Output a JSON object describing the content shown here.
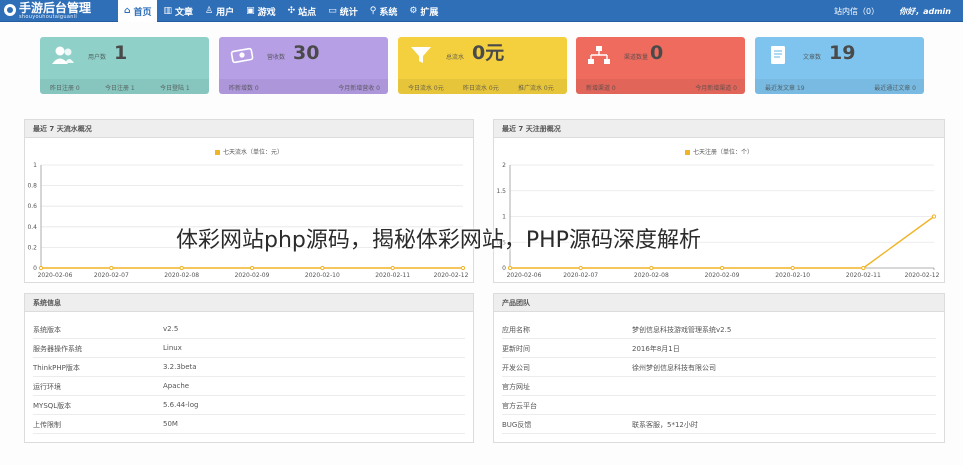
{
  "header": {
    "logo_title": "手游后台管理",
    "logo_sub": "shouyouhoutaiguanli",
    "nav": [
      {
        "label": "首页",
        "icon": "home-icon",
        "glyph": "⌂",
        "active": true
      },
      {
        "label": "文章",
        "icon": "bar-chart-icon",
        "glyph": "▥",
        "active": false
      },
      {
        "label": "用户",
        "icon": "user-icon",
        "glyph": "♙",
        "active": false
      },
      {
        "label": "游戏",
        "icon": "gamepad-icon",
        "glyph": "▣",
        "active": false
      },
      {
        "label": "站点",
        "icon": "sitemap-icon",
        "glyph": "✣",
        "active": false
      },
      {
        "label": "统计",
        "icon": "monitor-icon",
        "glyph": "▭",
        "active": false
      },
      {
        "label": "系统",
        "icon": "link-icon",
        "glyph": "⚲",
        "active": false
      },
      {
        "label": "扩展",
        "icon": "gear-icon",
        "glyph": "⚙",
        "active": false
      }
    ],
    "messages": "站内信（0）",
    "greeting": "你好，admin"
  },
  "cards": [
    {
      "color": "#8fd1c9",
      "icon": "users-icon",
      "label": "用户数",
      "value": "1",
      "foot": [
        "昨日注册 0",
        "今日注册 1",
        "今日登陆 1"
      ]
    },
    {
      "color": "#b79fe6",
      "icon": "money-icon",
      "label": "营收数",
      "value": "30",
      "foot": [
        "昨新增数 0",
        "今月新增营收 0"
      ]
    },
    {
      "color": "#f4d03f",
      "icon": "funnel-icon",
      "label": "总流水",
      "value": "0元",
      "foot": [
        "今日流水 0元",
        "昨日流水 0元",
        "推广流水 0元"
      ]
    },
    {
      "color": "#ee6b5e",
      "icon": "sitemap-icon",
      "label": "渠道数量",
      "value": "0",
      "foot": [
        "新增渠道 0",
        "今月新增渠道 0"
      ]
    },
    {
      "color": "#7fc4ee",
      "icon": "document-icon",
      "label": "文章数",
      "value": "19",
      "foot": [
        "最近发文章 19",
        "最近通过文章 0"
      ]
    }
  ],
  "charts": {
    "flow": {
      "title": "最近 7 天流水概况"
    },
    "register": {
      "title": "最近 7 天注册概况"
    }
  },
  "chart_data": [
    {
      "type": "line",
      "title": "最近 7 天流水概况",
      "x": [
        "2020-02-06",
        "2020-02-07",
        "2020-02-08",
        "2020-02-09",
        "2020-02-10",
        "2020-02-11",
        "2020-02-12"
      ],
      "series": [
        {
          "name": "七天流水（单位：元）",
          "values": [
            0,
            0,
            0,
            0,
            0,
            0,
            0
          ]
        }
      ],
      "yticks": [
        "0",
        "0.2",
        "0.4",
        "0.6",
        "0.8",
        "1"
      ],
      "ylim": [
        0,
        1
      ],
      "grid": true,
      "legend": "top-center",
      "line_color": "#f0b427"
    },
    {
      "type": "line",
      "title": "最近 7 天注册概况",
      "x": [
        "2020-02-06",
        "2020-02-07",
        "2020-02-08",
        "2020-02-09",
        "2020-02-10",
        "2020-02-11",
        "2020-02-12"
      ],
      "series": [
        {
          "name": "七天注册（单位：个）",
          "values": [
            0,
            0,
            0,
            0,
            0,
            0,
            1
          ]
        }
      ],
      "yticks": [
        "0",
        "0.5",
        "1",
        "1.5",
        "2"
      ],
      "ylim": [
        0,
        2
      ],
      "grid": true,
      "legend": "top-center",
      "line_color": "#f0b427"
    }
  ],
  "system_info": {
    "title": "系统信息",
    "rows": [
      {
        "k": "系统版本",
        "v": "v2.5"
      },
      {
        "k": "服务器操作系统",
        "v": "Linux"
      },
      {
        "k": "ThinkPHP版本",
        "v": "3.2.3beta"
      },
      {
        "k": "运行环境",
        "v": "Apache"
      },
      {
        "k": "MYSQL版本",
        "v": "5.6.44-log"
      },
      {
        "k": "上传限制",
        "v": "50M"
      }
    ]
  },
  "product_team": {
    "title": "产品团队",
    "rows": [
      {
        "k": "应用名称",
        "v": "梦创信息科技游戏管理系统v2.5"
      },
      {
        "k": "更新时间",
        "v": "2016年8月1日"
      },
      {
        "k": "开发公司",
        "v": "徐州梦创信息科技有限公司"
      },
      {
        "k": "官方网址",
        "v": ""
      },
      {
        "k": "官方云平台",
        "v": ""
      },
      {
        "k": "BUG反馈",
        "v": "联系客服，5*12小时"
      }
    ]
  },
  "overlay_text": "体彩网站php源码，揭秘体彩网站，PHP源码深度解析"
}
